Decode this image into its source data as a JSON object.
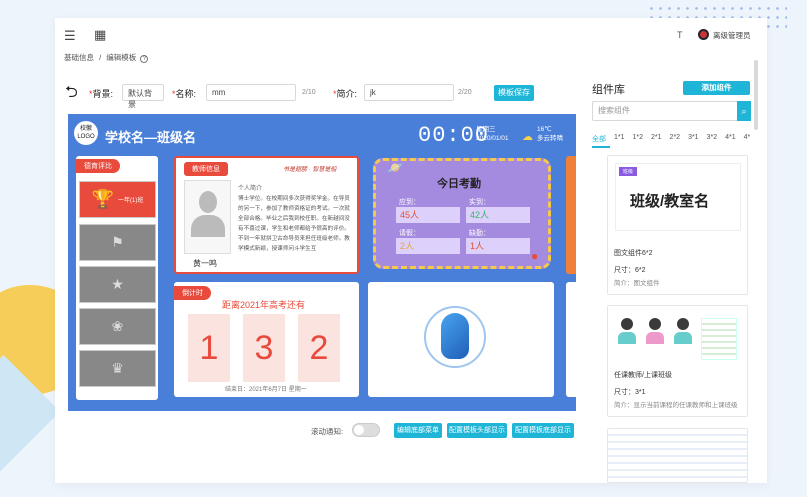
{
  "header": {
    "user_name": "离级管理员"
  },
  "breadcrumb": {
    "root": "基础信息",
    "sep": "/",
    "current": "编辑模板",
    "help": "?"
  },
  "form": {
    "bg_label": "背景:",
    "bg_value": "默认背景",
    "name_label": "名称:",
    "name_value": "mm",
    "name_count": "2/10",
    "intro_label": "简介:",
    "intro_value": "jk",
    "intro_count": "2/20",
    "save_btn": "模板保存"
  },
  "canvas": {
    "logo_text": "校徽 LOGO",
    "school_class": "学校名—班级名",
    "clock": "00:00",
    "weekday": "星期三",
    "date": "2020/01/01",
    "temp": "16℃",
    "weather": "多云转晴",
    "honor_title": "德育评比",
    "honor_first": "一年(1)班",
    "teacher_tag": "教师信息",
    "teacher_motto": "书是翅膀 · 智慧是船",
    "teacher_name": "黄一鸣",
    "teacher_intro_label": "个人简介",
    "teacher_intro": "博士学位。在校期间多次获得奖学金。在导员的另一下，参加了教师资格证的考试。一次就全部合格。毕业之后我到校任职。在新越间没有不喜过课，学生和老师都给予很高的评价。不到一年就拼卫古命导员来担任班级老师。教学模式新颖，授课师问斗学生互",
    "countdown_tag": "倒计时",
    "countdown_title": "距离2021年高考还有",
    "digits": [
      "1",
      "3",
      "2"
    ],
    "countdown_end": "结束日：2021年6月7日 星期一",
    "att_title": "今日考勤",
    "att_labels": [
      "应到：",
      "实到：",
      "请假：",
      "缺勤："
    ],
    "att_values": [
      "45人",
      "42人",
      "2人",
      "1人"
    ]
  },
  "bottom": {
    "toggle_label": "滚动通知:",
    "btn_edit": "编辑底部菜单",
    "btn_head": "配置模板头部显示",
    "btn_foot": "配置模板底部显示"
  },
  "library": {
    "title": "组件库",
    "add_btn": "添加组件",
    "search_placeholder": "搜索组件",
    "tabs": [
      "全部",
      "1*1",
      "1*2",
      "2*1",
      "2*2",
      "3*1",
      "3*2",
      "4*1",
      "4*"
    ],
    "card1_badge": "班级",
    "card1_text": "班级/教室名",
    "card1_name": "图文组件6*2",
    "card1_size": "尺寸：6*2",
    "card1_desc": "简介：图文组件",
    "card2_name": "任课教师/上课班级",
    "card2_size": "尺寸：3*1",
    "card2_desc": "简介：显示当前课程的任课教师和上课班级"
  },
  "colors": {
    "accent": "#1fb5d7",
    "canvas_bg": "#4a7fd9",
    "red": "#e84a3c",
    "purple": "#a58be0"
  }
}
